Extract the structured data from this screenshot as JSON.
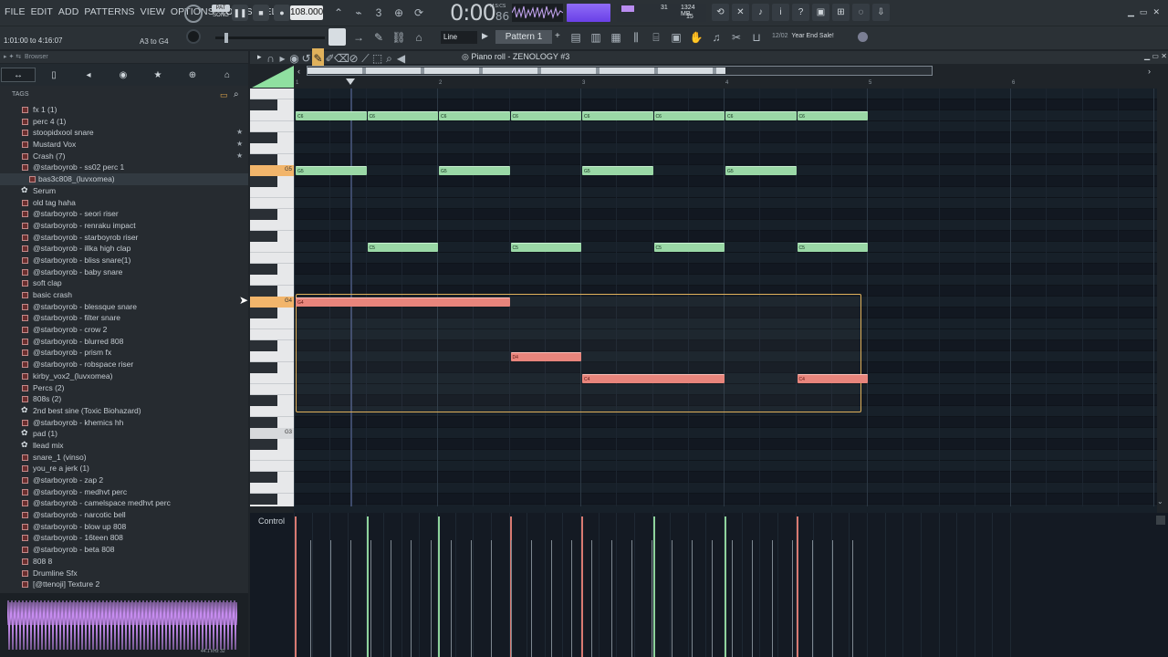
{
  "menu": [
    "FILE",
    "EDIT",
    "ADD",
    "PATTERNS",
    "VIEW",
    "OPTIONS",
    "TOOLS",
    "HELP"
  ],
  "hint": "1:01:00 to 4:16:07",
  "hint_range": "A3 to G4",
  "pattern_mode": {
    "pat": "PAT",
    "song": "SONG"
  },
  "tempo": "108.000",
  "time": {
    "main": "0:00",
    "sub": "86",
    "label": "M:S:CS"
  },
  "cpu": {
    "value": "31",
    "memory": "1324 MB",
    "polyphony": "15"
  },
  "snap": "Line",
  "pattern": "Pattern 1",
  "promo": {
    "date": "12/02",
    "text": "Year End Sale!"
  },
  "browser": {
    "title": "Browser",
    "tags_label": "TAGS"
  },
  "browser_items": [
    {
      "label": "fx 1 (1)",
      "star": false
    },
    {
      "label": "perc 4 (1)",
      "star": false
    },
    {
      "label": "stoopidxool snare",
      "star": true
    },
    {
      "label": "Mustard Vox",
      "star": true
    },
    {
      "label": "Crash (7)",
      "star": true
    },
    {
      "label": "@starboyrob - ss02 perc 1",
      "star": false
    },
    {
      "label": "bas3c808_(luvxomea)",
      "star": false,
      "sub": true,
      "selected": true
    },
    {
      "label": "Serum",
      "star": false,
      "gear": true
    },
    {
      "label": "old tag haha",
      "star": false
    },
    {
      "label": "@starboyrob - seori riser",
      "star": false
    },
    {
      "label": "@starboyrob - renraku impact",
      "star": false
    },
    {
      "label": "@starboyrob - starboyrob riser",
      "star": false
    },
    {
      "label": "@starboyrob - illka high clap",
      "star": false
    },
    {
      "label": "@starboyrob - bliss snare(1)",
      "star": false
    },
    {
      "label": "@starboyrob - baby snare",
      "star": false
    },
    {
      "label": "soft clap",
      "star": false
    },
    {
      "label": "basic crash",
      "star": false
    },
    {
      "label": "@starboyrob - blessque snare",
      "star": false
    },
    {
      "label": "@starboyrob - filter snare",
      "star": false
    },
    {
      "label": "@starboyrob - crow 2",
      "star": false
    },
    {
      "label": "@starboyrob - blurred 808",
      "star": false
    },
    {
      "label": "@starboyrob - prism fx",
      "star": false
    },
    {
      "label": "@starboyrob - robspace riser",
      "star": false
    },
    {
      "label": "kirby_vox2_(luvxomea)",
      "star": false
    },
    {
      "label": "Percs (2)",
      "star": false
    },
    {
      "label": "808s (2)",
      "star": false
    },
    {
      "label": "2nd best sine (Toxic Biohazard)",
      "star": false,
      "gear": true
    },
    {
      "label": "@starboyrob - khemics hh",
      "star": false
    },
    {
      "label": "pad (1)",
      "star": false,
      "gear": true
    },
    {
      "label": "llead mix",
      "star": false,
      "gear": true
    },
    {
      "label": "snare_1 (vinso)",
      "star": false
    },
    {
      "label": "you_re a jerk (1)",
      "star": false
    },
    {
      "label": "@starboyrob - zap 2",
      "star": false
    },
    {
      "label": "@starboyrob - medhvt perc",
      "star": false
    },
    {
      "label": "@starboyrob - camelspace medhvt perc",
      "star": false
    },
    {
      "label": "@starboyrob - narcotic bell",
      "star": false
    },
    {
      "label": "@starboyrob - blow up 808",
      "star": false
    },
    {
      "label": "@starboyrob - 16teen 808",
      "star": false
    },
    {
      "label": "@starboyrob - beta 808",
      "star": false
    },
    {
      "label": "808 8",
      "star": false
    },
    {
      "label": "Drumline Sfx",
      "star": false
    },
    {
      "label": "[@ttenoji] Texture 2",
      "star": false
    }
  ],
  "waveform_info": "44.1 kHz 32",
  "piano_roll": {
    "title": "Piano roll - ZENOLOGY #3",
    "key_labels": {
      "g5": "G5",
      "g4": "G4",
      "g3": "G3"
    },
    "bars": [
      "1",
      "2",
      "3",
      "4",
      "5",
      "6"
    ]
  },
  "notes": [
    {
      "pitch": "C6",
      "start": 0,
      "len": 0.5
    },
    {
      "pitch": "C6",
      "start": 0.5,
      "len": 0.5
    },
    {
      "pitch": "C6",
      "start": 1,
      "len": 0.5
    },
    {
      "pitch": "C6",
      "start": 1.5,
      "len": 0.5
    },
    {
      "pitch": "C6",
      "start": 2,
      "len": 0.5
    },
    {
      "pitch": "C6",
      "start": 2.5,
      "len": 0.5
    },
    {
      "pitch": "C6",
      "start": 3,
      "len": 0.5
    },
    {
      "pitch": "C6",
      "start": 3.5,
      "len": 0.5
    },
    {
      "pitch": "G5",
      "start": 0,
      "len": 0.5
    },
    {
      "pitch": "G5",
      "start": 1,
      "len": 0.5
    },
    {
      "pitch": "G5",
      "start": 2,
      "len": 0.5
    },
    {
      "pitch": "G5",
      "start": 3,
      "len": 0.5
    },
    {
      "pitch": "C5",
      "start": 0.5,
      "len": 0.5
    },
    {
      "pitch": "C5",
      "start": 1.5,
      "len": 0.5
    },
    {
      "pitch": "C5",
      "start": 2.5,
      "len": 0.5
    },
    {
      "pitch": "C5",
      "start": 3.5,
      "len": 0.5
    },
    {
      "pitch": "G4",
      "start": 0,
      "len": 1.5,
      "selected": true
    },
    {
      "pitch": "D4",
      "start": 1.5,
      "len": 0.5,
      "selected": true
    },
    {
      "pitch": "C4",
      "start": 2,
      "len": 1,
      "selected": true
    },
    {
      "pitch": "C4",
      "start": 3.5,
      "len": 0.5,
      "selected": true
    }
  ],
  "control_label": "Control"
}
